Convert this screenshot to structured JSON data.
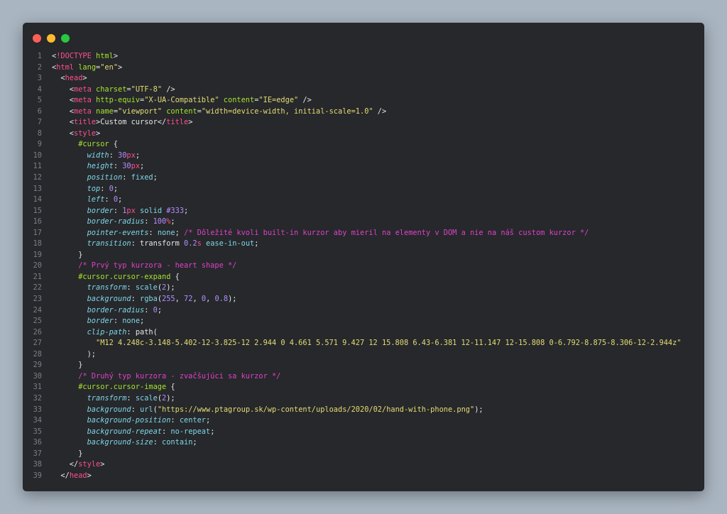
{
  "window": {
    "controls": [
      {
        "name": "close",
        "color": "#ff5f57"
      },
      {
        "name": "minimize",
        "color": "#febc2e"
      },
      {
        "name": "maximize",
        "color": "#28c840"
      }
    ]
  },
  "code": {
    "lines": [
      {
        "n": "1",
        "tokens": [
          {
            "t": "<",
            "c": "punc"
          },
          {
            "t": "!DOCTYPE",
            "c": "tag"
          },
          {
            "t": " html",
            "c": "attr"
          },
          {
            "t": ">",
            "c": "punc"
          }
        ]
      },
      {
        "n": "2",
        "tokens": [
          {
            "t": "<",
            "c": "punc"
          },
          {
            "t": "html",
            "c": "tag"
          },
          {
            "t": " lang",
            "c": "attr"
          },
          {
            "t": "=",
            "c": "punc"
          },
          {
            "t": "\"en\"",
            "c": "str"
          },
          {
            "t": ">",
            "c": "punc"
          }
        ]
      },
      {
        "n": "3",
        "tokens": [
          {
            "t": "  ",
            "c": "punc"
          },
          {
            "t": "<",
            "c": "punc"
          },
          {
            "t": "head",
            "c": "tag"
          },
          {
            "t": ">",
            "c": "punc"
          }
        ]
      },
      {
        "n": "4",
        "tokens": [
          {
            "t": "    <",
            "c": "punc"
          },
          {
            "t": "meta",
            "c": "tag"
          },
          {
            "t": " charset",
            "c": "attr"
          },
          {
            "t": "=",
            "c": "punc"
          },
          {
            "t": "\"UTF-8\"",
            "c": "str"
          },
          {
            "t": " />",
            "c": "punc"
          }
        ]
      },
      {
        "n": "5",
        "tokens": [
          {
            "t": "    <",
            "c": "punc"
          },
          {
            "t": "meta",
            "c": "tag"
          },
          {
            "t": " http-equiv",
            "c": "attr"
          },
          {
            "t": "=",
            "c": "punc"
          },
          {
            "t": "\"X-UA-Compatible\"",
            "c": "str"
          },
          {
            "t": " content",
            "c": "attr"
          },
          {
            "t": "=",
            "c": "punc"
          },
          {
            "t": "\"IE=edge\"",
            "c": "str"
          },
          {
            "t": " />",
            "c": "punc"
          }
        ]
      },
      {
        "n": "6",
        "tokens": [
          {
            "t": "    <",
            "c": "punc"
          },
          {
            "t": "meta",
            "c": "tag"
          },
          {
            "t": " name",
            "c": "attr"
          },
          {
            "t": "=",
            "c": "punc"
          },
          {
            "t": "\"viewport\"",
            "c": "str"
          },
          {
            "t": " content",
            "c": "attr"
          },
          {
            "t": "=",
            "c": "punc"
          },
          {
            "t": "\"width=device-width, initial-scale=1.0\"",
            "c": "str"
          },
          {
            "t": " />",
            "c": "punc"
          }
        ]
      },
      {
        "n": "7",
        "tokens": [
          {
            "t": "    <",
            "c": "punc"
          },
          {
            "t": "title",
            "c": "tag"
          },
          {
            "t": ">",
            "c": "punc"
          },
          {
            "t": "Custom cursor",
            "c": "text"
          },
          {
            "t": "</",
            "c": "punc"
          },
          {
            "t": "title",
            "c": "tag"
          },
          {
            "t": ">",
            "c": "punc"
          }
        ]
      },
      {
        "n": "8",
        "tokens": [
          {
            "t": "    <",
            "c": "punc"
          },
          {
            "t": "style",
            "c": "tag"
          },
          {
            "t": ">",
            "c": "punc"
          }
        ]
      },
      {
        "n": "9",
        "tokens": [
          {
            "t": "      ",
            "c": "punc"
          },
          {
            "t": "#cursor",
            "c": "sel"
          },
          {
            "t": " {",
            "c": "punc"
          }
        ]
      },
      {
        "n": "10",
        "tokens": [
          {
            "t": "        ",
            "c": "punc"
          },
          {
            "t": "width",
            "c": "prop"
          },
          {
            "t": ": ",
            "c": "punc"
          },
          {
            "t": "30",
            "c": "num"
          },
          {
            "t": "px",
            "c": "unit"
          },
          {
            "t": ";",
            "c": "punc"
          }
        ]
      },
      {
        "n": "11",
        "tokens": [
          {
            "t": "        ",
            "c": "punc"
          },
          {
            "t": "height",
            "c": "prop"
          },
          {
            "t": ": ",
            "c": "punc"
          },
          {
            "t": "30",
            "c": "num"
          },
          {
            "t": "px",
            "c": "unit"
          },
          {
            "t": ";",
            "c": "punc"
          }
        ]
      },
      {
        "n": "12",
        "tokens": [
          {
            "t": "        ",
            "c": "punc"
          },
          {
            "t": "position",
            "c": "prop"
          },
          {
            "t": ": ",
            "c": "punc"
          },
          {
            "t": "fixed",
            "c": "val"
          },
          {
            "t": ";",
            "c": "punc"
          }
        ]
      },
      {
        "n": "13",
        "tokens": [
          {
            "t": "        ",
            "c": "punc"
          },
          {
            "t": "top",
            "c": "prop"
          },
          {
            "t": ": ",
            "c": "punc"
          },
          {
            "t": "0",
            "c": "num"
          },
          {
            "t": ";",
            "c": "punc"
          }
        ]
      },
      {
        "n": "14",
        "tokens": [
          {
            "t": "        ",
            "c": "punc"
          },
          {
            "t": "left",
            "c": "prop"
          },
          {
            "t": ": ",
            "c": "punc"
          },
          {
            "t": "0",
            "c": "num"
          },
          {
            "t": ";",
            "c": "punc"
          }
        ]
      },
      {
        "n": "15",
        "tokens": [
          {
            "t": "        ",
            "c": "punc"
          },
          {
            "t": "border",
            "c": "prop"
          },
          {
            "t": ": ",
            "c": "punc"
          },
          {
            "t": "1",
            "c": "num"
          },
          {
            "t": "px",
            "c": "unit"
          },
          {
            "t": " solid ",
            "c": "val"
          },
          {
            "t": "#333",
            "c": "num"
          },
          {
            "t": ";",
            "c": "punc"
          }
        ]
      },
      {
        "n": "16",
        "tokens": [
          {
            "t": "        ",
            "c": "punc"
          },
          {
            "t": "border-radius",
            "c": "prop"
          },
          {
            "t": ": ",
            "c": "punc"
          },
          {
            "t": "100",
            "c": "num"
          },
          {
            "t": "%",
            "c": "unit"
          },
          {
            "t": ";",
            "c": "punc"
          }
        ]
      },
      {
        "n": "17",
        "tokens": [
          {
            "t": "        ",
            "c": "punc"
          },
          {
            "t": "pointer-events",
            "c": "prop"
          },
          {
            "t": ": ",
            "c": "punc"
          },
          {
            "t": "none",
            "c": "val"
          },
          {
            "t": "; ",
            "c": "punc"
          },
          {
            "t": "/* Dôležité kvoli built-in kurzor aby mieril na elementy v DOM a nie na náš custom kurzor */",
            "c": "com"
          }
        ]
      },
      {
        "n": "18",
        "tokens": [
          {
            "t": "        ",
            "c": "punc"
          },
          {
            "t": "transition",
            "c": "prop"
          },
          {
            "t": ": ",
            "c": "punc"
          },
          {
            "t": "transform ",
            "c": "text"
          },
          {
            "t": "0.2",
            "c": "num"
          },
          {
            "t": "s",
            "c": "unit"
          },
          {
            "t": " ease-in-out",
            "c": "val"
          },
          {
            "t": ";",
            "c": "punc"
          }
        ]
      },
      {
        "n": "19",
        "tokens": [
          {
            "t": "      }",
            "c": "punc"
          }
        ]
      },
      {
        "n": "20",
        "tokens": [
          {
            "t": "      ",
            "c": "punc"
          },
          {
            "t": "/* Prvý typ kurzora - heart shape */",
            "c": "com"
          }
        ]
      },
      {
        "n": "21",
        "tokens": [
          {
            "t": "      ",
            "c": "punc"
          },
          {
            "t": "#cursor.cursor-expand",
            "c": "sel"
          },
          {
            "t": " {",
            "c": "punc"
          }
        ]
      },
      {
        "n": "22",
        "tokens": [
          {
            "t": "        ",
            "c": "punc"
          },
          {
            "t": "transform",
            "c": "prop"
          },
          {
            "t": ": ",
            "c": "punc"
          },
          {
            "t": "scale",
            "c": "func"
          },
          {
            "t": "(",
            "c": "punc"
          },
          {
            "t": "2",
            "c": "num"
          },
          {
            "t": ");",
            "c": "punc"
          }
        ]
      },
      {
        "n": "23",
        "tokens": [
          {
            "t": "        ",
            "c": "punc"
          },
          {
            "t": "background",
            "c": "prop"
          },
          {
            "t": ": ",
            "c": "punc"
          },
          {
            "t": "rgba",
            "c": "func"
          },
          {
            "t": "(",
            "c": "punc"
          },
          {
            "t": "255",
            "c": "num"
          },
          {
            "t": ", ",
            "c": "punc"
          },
          {
            "t": "72",
            "c": "num"
          },
          {
            "t": ", ",
            "c": "punc"
          },
          {
            "t": "0",
            "c": "num"
          },
          {
            "t": ", ",
            "c": "punc"
          },
          {
            "t": "0.8",
            "c": "num"
          },
          {
            "t": ");",
            "c": "punc"
          }
        ]
      },
      {
        "n": "24",
        "tokens": [
          {
            "t": "        ",
            "c": "punc"
          },
          {
            "t": "border-radius",
            "c": "prop"
          },
          {
            "t": ": ",
            "c": "punc"
          },
          {
            "t": "0",
            "c": "num"
          },
          {
            "t": ";",
            "c": "punc"
          }
        ]
      },
      {
        "n": "25",
        "tokens": [
          {
            "t": "        ",
            "c": "punc"
          },
          {
            "t": "border",
            "c": "prop"
          },
          {
            "t": ": ",
            "c": "punc"
          },
          {
            "t": "none",
            "c": "val"
          },
          {
            "t": ";",
            "c": "punc"
          }
        ]
      },
      {
        "n": "26",
        "tokens": [
          {
            "t": "        ",
            "c": "punc"
          },
          {
            "t": "clip-path",
            "c": "prop"
          },
          {
            "t": ": ",
            "c": "punc"
          },
          {
            "t": "path",
            "c": "text"
          },
          {
            "t": "(",
            "c": "punc"
          }
        ]
      },
      {
        "n": "27",
        "tokens": [
          {
            "t": "          ",
            "c": "punc"
          },
          {
            "t": "\"M12 4.248c-3.148-5.402-12-3.825-12 2.944 0 4.661 5.571 9.427 12 15.808 6.43-6.381 12-11.147 12-15.808 0-6.792-8.875-8.306-12-2.944z\"",
            "c": "str"
          }
        ]
      },
      {
        "n": "28",
        "tokens": [
          {
            "t": "        );",
            "c": "punc"
          }
        ]
      },
      {
        "n": "29",
        "tokens": [
          {
            "t": "      }",
            "c": "punc"
          }
        ]
      },
      {
        "n": "30",
        "tokens": [
          {
            "t": "      ",
            "c": "punc"
          },
          {
            "t": "/* Druhý typ kurzora - zvačšujúci sa kurzor */",
            "c": "com"
          }
        ]
      },
      {
        "n": "31",
        "tokens": [
          {
            "t": "      ",
            "c": "punc"
          },
          {
            "t": "#cursor.cursor-image",
            "c": "sel"
          },
          {
            "t": " {",
            "c": "punc"
          }
        ]
      },
      {
        "n": "32",
        "tokens": [
          {
            "t": "        ",
            "c": "punc"
          },
          {
            "t": "transform",
            "c": "prop"
          },
          {
            "t": ": ",
            "c": "punc"
          },
          {
            "t": "scale",
            "c": "func"
          },
          {
            "t": "(",
            "c": "punc"
          },
          {
            "t": "2",
            "c": "num"
          },
          {
            "t": ");",
            "c": "punc"
          }
        ]
      },
      {
        "n": "33",
        "tokens": [
          {
            "t": "        ",
            "c": "punc"
          },
          {
            "t": "background",
            "c": "prop"
          },
          {
            "t": ": ",
            "c": "punc"
          },
          {
            "t": "url",
            "c": "func"
          },
          {
            "t": "(",
            "c": "punc"
          },
          {
            "t": "\"https://www.ptagroup.sk/wp-content/uploads/2020/02/hand-with-phone.png\"",
            "c": "str"
          },
          {
            "t": ");",
            "c": "punc"
          }
        ]
      },
      {
        "n": "34",
        "tokens": [
          {
            "t": "        ",
            "c": "punc"
          },
          {
            "t": "background-position",
            "c": "prop"
          },
          {
            "t": ": ",
            "c": "punc"
          },
          {
            "t": "center",
            "c": "val"
          },
          {
            "t": ";",
            "c": "punc"
          }
        ]
      },
      {
        "n": "35",
        "tokens": [
          {
            "t": "        ",
            "c": "punc"
          },
          {
            "t": "background-repeat",
            "c": "prop"
          },
          {
            "t": ": ",
            "c": "punc"
          },
          {
            "t": "no-repeat",
            "c": "val"
          },
          {
            "t": ";",
            "c": "punc"
          }
        ]
      },
      {
        "n": "36",
        "tokens": [
          {
            "t": "        ",
            "c": "punc"
          },
          {
            "t": "background-size",
            "c": "prop"
          },
          {
            "t": ": ",
            "c": "punc"
          },
          {
            "t": "contain",
            "c": "val"
          },
          {
            "t": ";",
            "c": "punc"
          }
        ]
      },
      {
        "n": "37",
        "tokens": [
          {
            "t": "      }",
            "c": "punc"
          }
        ]
      },
      {
        "n": "38",
        "tokens": [
          {
            "t": "    </",
            "c": "punc"
          },
          {
            "t": "style",
            "c": "tag"
          },
          {
            "t": ">",
            "c": "punc"
          }
        ]
      },
      {
        "n": "39",
        "tokens": [
          {
            "t": "  </",
            "c": "punc"
          },
          {
            "t": "head",
            "c": "tag"
          },
          {
            "t": ">",
            "c": "punc"
          }
        ]
      }
    ]
  }
}
